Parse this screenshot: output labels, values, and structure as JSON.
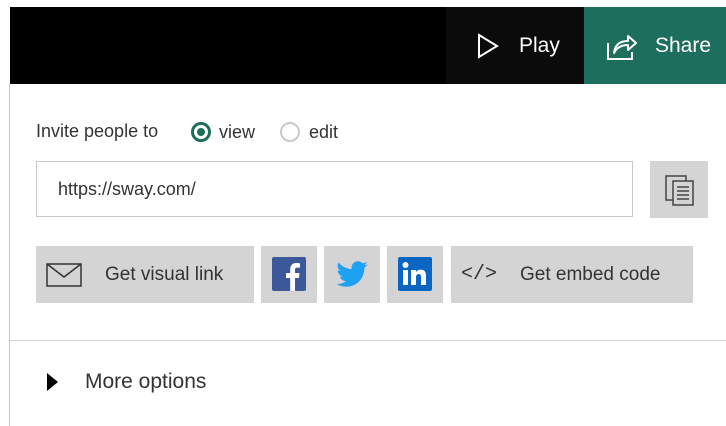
{
  "header": {
    "play_label": "Play",
    "share_label": "Share",
    "accent_color": "#1e6e5e"
  },
  "invite": {
    "label": "Invite people to",
    "options": [
      {
        "label": "view",
        "selected": true
      },
      {
        "label": "edit",
        "selected": false
      }
    ]
  },
  "link": {
    "url": "https://sway.com/"
  },
  "actions": {
    "visual_link_label": "Get visual link",
    "embed_icon": "</>",
    "embed_label": "Get embed code",
    "social": [
      "facebook",
      "twitter",
      "linkedin"
    ]
  },
  "more_options_label": "More options"
}
